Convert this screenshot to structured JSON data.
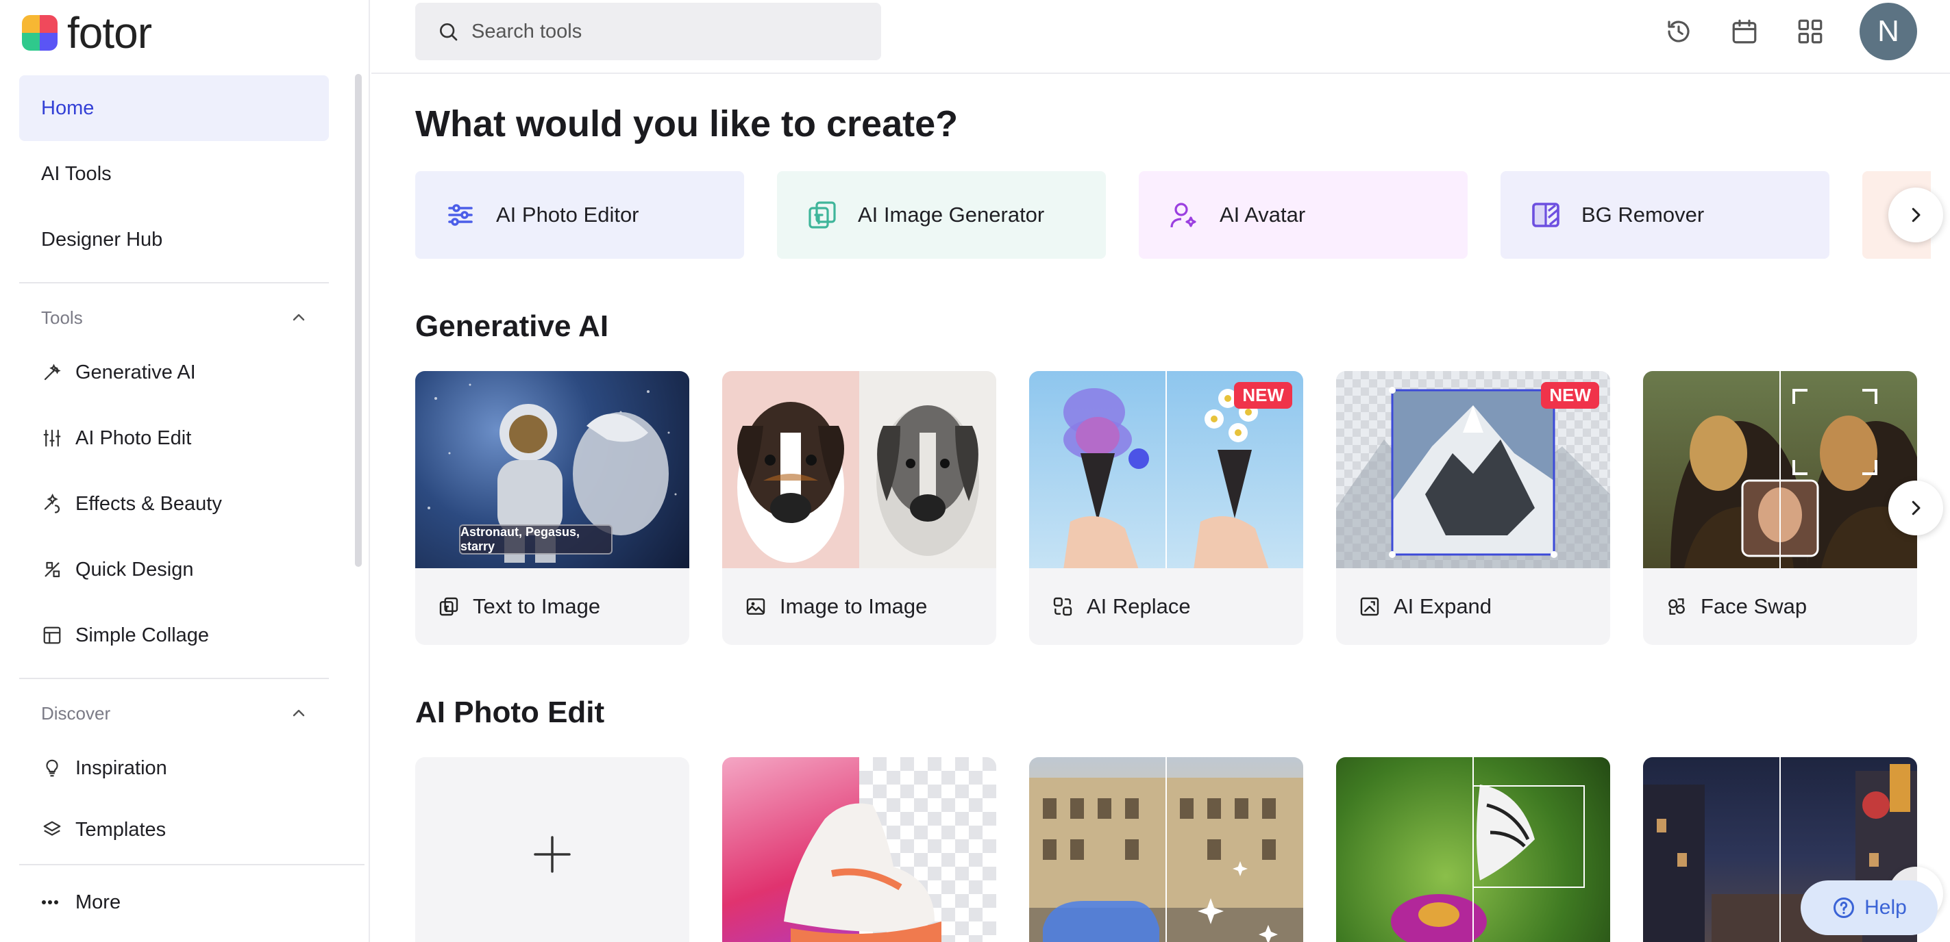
{
  "brand": {
    "name": "fotor"
  },
  "sidebar": {
    "nav": [
      {
        "label": "Home"
      },
      {
        "label": "AI Tools"
      },
      {
        "label": "Designer Hub"
      }
    ],
    "tools_section": {
      "title": "Tools",
      "items": [
        {
          "label": "Generative AI",
          "icon": "wand-icon"
        },
        {
          "label": "AI Photo Edit",
          "icon": "sliders-icon"
        },
        {
          "label": "Effects & Beauty",
          "icon": "sparkle-icon"
        },
        {
          "label": "Quick Design",
          "icon": "design-icon"
        },
        {
          "label": "Simple Collage",
          "icon": "collage-icon"
        }
      ]
    },
    "discover_section": {
      "title": "Discover",
      "items": [
        {
          "label": "Inspiration",
          "icon": "lightbulb-icon"
        },
        {
          "label": "Templates",
          "icon": "layers-icon"
        }
      ]
    },
    "more_label": "More"
  },
  "header": {
    "search_placeholder": "Search tools",
    "avatar_initial": "N"
  },
  "main": {
    "heading": "What would you like to create?",
    "quick_actions": [
      {
        "label": "AI Photo Editor",
        "bg": "#eef0fc",
        "icon_color": "#4b5ee8"
      },
      {
        "label": "AI Image Generator",
        "bg": "#eef8f5",
        "icon_color": "#3fb59a"
      },
      {
        "label": "AI Avatar",
        "bg": "#fbefff",
        "icon_color": "#9b3fe0"
      },
      {
        "label": "BG Remover",
        "bg": "#efeffc",
        "icon_color": "#6d4fe0"
      }
    ],
    "generative_ai": {
      "title": "Generative AI",
      "cards": [
        {
          "label": "Text to Image",
          "caption": "Astronaut, Pegasus, starry",
          "badge": ""
        },
        {
          "label": "Image to Image",
          "badge": ""
        },
        {
          "label": "AI Replace",
          "badge": "NEW"
        },
        {
          "label": "AI Expand",
          "badge": "NEW"
        },
        {
          "label": "Face Swap",
          "badge": ""
        }
      ]
    },
    "ai_photo_edit": {
      "title": "AI Photo Edit"
    }
  },
  "help_label": "Help"
}
